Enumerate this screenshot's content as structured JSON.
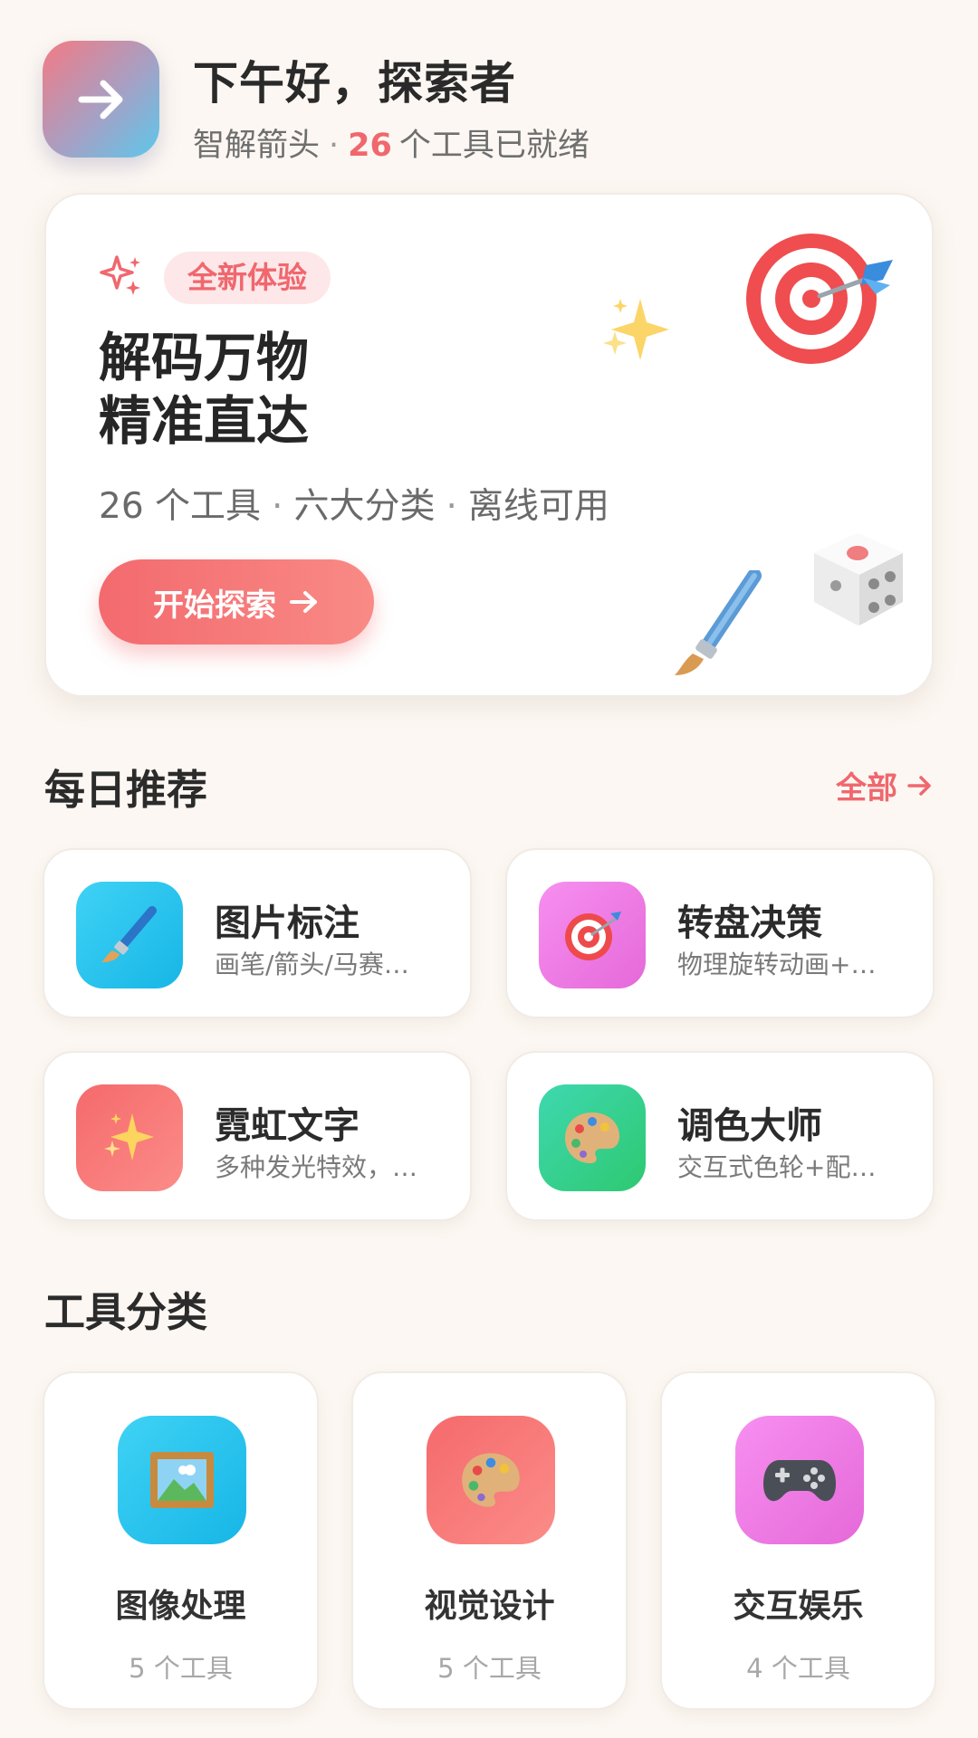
{
  "header": {
    "greeting": "下午好，探索者",
    "app_name": "智解箭头",
    "separator": "·",
    "tool_count": "26",
    "ready_text": "个工具已就绪"
  },
  "hero": {
    "badge": "全新体验",
    "title_line1": "解码万物",
    "title_line2": "精准直达",
    "desc_tools": "26 个工具",
    "desc_categories": "六大分类",
    "desc_offline": "离线可用",
    "separator": "·",
    "cta_label": "开始探索"
  },
  "daily": {
    "title": "每日推荐",
    "see_all": "全部",
    "items": [
      {
        "name": "图片标注",
        "desc": "画笔/箭头/马赛…",
        "icon": "paintbrush-icon",
        "color": "#1fbbe9"
      },
      {
        "name": "转盘决策",
        "desc": "物理旋转动画+…",
        "icon": "target-icon",
        "color": "#ee78e3"
      },
      {
        "name": "霓虹文字",
        "desc": "多种发光特效，…",
        "icon": "sparkles-icon",
        "color": "#f77b7b"
      },
      {
        "name": "调色大师",
        "desc": "交互式色轮+配…",
        "icon": "palette-icon",
        "color": "#35d08e"
      }
    ]
  },
  "categories": {
    "title": "工具分类",
    "items": [
      {
        "name": "图像处理",
        "count": "5 个工具",
        "icon": "framed-picture-icon",
        "color": "#20bde9"
      },
      {
        "name": "视觉设计",
        "count": "5 个工具",
        "icon": "palette-icon",
        "color": "#f77b7b"
      },
      {
        "name": "交互娱乐",
        "count": "4 个工具",
        "icon": "game-controller-icon",
        "color": "#ee78e3"
      }
    ]
  },
  "colors": {
    "accent": "#f0676e",
    "background": "#fcf7f2"
  }
}
